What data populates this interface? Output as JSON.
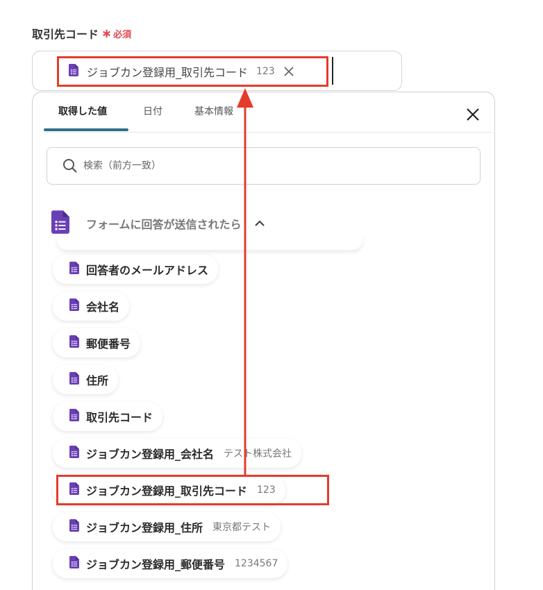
{
  "field": {
    "label": "取引先コード",
    "required_mark": "∗",
    "required_text": "必須",
    "selected": {
      "label": "ジョブカン登録用_取引先コード",
      "value": "123"
    }
  },
  "tabs": [
    {
      "label": "取得した値",
      "active": true
    },
    {
      "label": "日付",
      "active": false
    },
    {
      "label": "基本情報",
      "active": false
    }
  ],
  "search": {
    "placeholder": "検索（前方一致）"
  },
  "section": {
    "title": "フォームに回答が送信されたら"
  },
  "items": [
    {
      "label": "回答者のメールアドレス",
      "value": ""
    },
    {
      "label": "会社名",
      "value": ""
    },
    {
      "label": "郵便番号",
      "value": ""
    },
    {
      "label": "住所",
      "value": ""
    },
    {
      "label": "取引先コード",
      "value": ""
    },
    {
      "label": "ジョブカン登録用_会社名",
      "value": "テスト株式会社"
    },
    {
      "label": "ジョブカン登録用_取引先コード",
      "value": "123"
    },
    {
      "label": "ジョブカン登録用_住所",
      "value": "東京都テスト"
    },
    {
      "label": "ジョブカン登録用_郵便番号",
      "value": "1234567"
    }
  ],
  "colors": {
    "accent": "#2f6f87",
    "required": "#e0474c",
    "highlight": "#e43b2c",
    "forms_icon": "#6a3fb5"
  },
  "icons": {
    "doc": "google-forms-icon",
    "clear": "close-icon",
    "close": "close-icon",
    "search": "search-icon",
    "chevron": "chevron-up-icon"
  }
}
